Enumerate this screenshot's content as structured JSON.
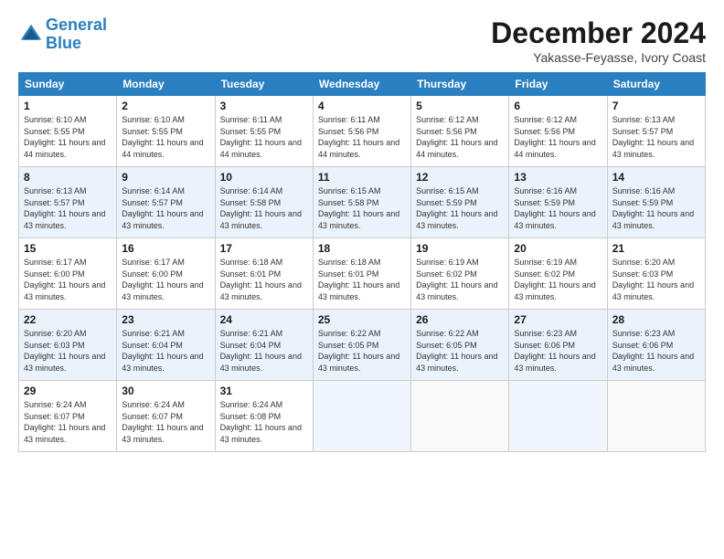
{
  "header": {
    "logo_line1": "General",
    "logo_line2": "Blue",
    "month_title": "December 2024",
    "location": "Yakasse-Feyasse, Ivory Coast"
  },
  "days_of_week": [
    "Sunday",
    "Monday",
    "Tuesday",
    "Wednesday",
    "Thursday",
    "Friday",
    "Saturday"
  ],
  "weeks": [
    [
      {
        "day": 1,
        "sunrise": "6:10 AM",
        "sunset": "5:55 PM",
        "daylight": "11 hours and 44 minutes."
      },
      {
        "day": 2,
        "sunrise": "6:10 AM",
        "sunset": "5:55 PM",
        "daylight": "11 hours and 44 minutes."
      },
      {
        "day": 3,
        "sunrise": "6:11 AM",
        "sunset": "5:55 PM",
        "daylight": "11 hours and 44 minutes."
      },
      {
        "day": 4,
        "sunrise": "6:11 AM",
        "sunset": "5:56 PM",
        "daylight": "11 hours and 44 minutes."
      },
      {
        "day": 5,
        "sunrise": "6:12 AM",
        "sunset": "5:56 PM",
        "daylight": "11 hours and 44 minutes."
      },
      {
        "day": 6,
        "sunrise": "6:12 AM",
        "sunset": "5:56 PM",
        "daylight": "11 hours and 44 minutes."
      },
      {
        "day": 7,
        "sunrise": "6:13 AM",
        "sunset": "5:57 PM",
        "daylight": "11 hours and 43 minutes."
      }
    ],
    [
      {
        "day": 8,
        "sunrise": "6:13 AM",
        "sunset": "5:57 PM",
        "daylight": "11 hours and 43 minutes."
      },
      {
        "day": 9,
        "sunrise": "6:14 AM",
        "sunset": "5:57 PM",
        "daylight": "11 hours and 43 minutes."
      },
      {
        "day": 10,
        "sunrise": "6:14 AM",
        "sunset": "5:58 PM",
        "daylight": "11 hours and 43 minutes."
      },
      {
        "day": 11,
        "sunrise": "6:15 AM",
        "sunset": "5:58 PM",
        "daylight": "11 hours and 43 minutes."
      },
      {
        "day": 12,
        "sunrise": "6:15 AM",
        "sunset": "5:59 PM",
        "daylight": "11 hours and 43 minutes."
      },
      {
        "day": 13,
        "sunrise": "6:16 AM",
        "sunset": "5:59 PM",
        "daylight": "11 hours and 43 minutes."
      },
      {
        "day": 14,
        "sunrise": "6:16 AM",
        "sunset": "5:59 PM",
        "daylight": "11 hours and 43 minutes."
      }
    ],
    [
      {
        "day": 15,
        "sunrise": "6:17 AM",
        "sunset": "6:00 PM",
        "daylight": "11 hours and 43 minutes."
      },
      {
        "day": 16,
        "sunrise": "6:17 AM",
        "sunset": "6:00 PM",
        "daylight": "11 hours and 43 minutes."
      },
      {
        "day": 17,
        "sunrise": "6:18 AM",
        "sunset": "6:01 PM",
        "daylight": "11 hours and 43 minutes."
      },
      {
        "day": 18,
        "sunrise": "6:18 AM",
        "sunset": "6:01 PM",
        "daylight": "11 hours and 43 minutes."
      },
      {
        "day": 19,
        "sunrise": "6:19 AM",
        "sunset": "6:02 PM",
        "daylight": "11 hours and 43 minutes."
      },
      {
        "day": 20,
        "sunrise": "6:19 AM",
        "sunset": "6:02 PM",
        "daylight": "11 hours and 43 minutes."
      },
      {
        "day": 21,
        "sunrise": "6:20 AM",
        "sunset": "6:03 PM",
        "daylight": "11 hours and 43 minutes."
      }
    ],
    [
      {
        "day": 22,
        "sunrise": "6:20 AM",
        "sunset": "6:03 PM",
        "daylight": "11 hours and 43 minutes."
      },
      {
        "day": 23,
        "sunrise": "6:21 AM",
        "sunset": "6:04 PM",
        "daylight": "11 hours and 43 minutes."
      },
      {
        "day": 24,
        "sunrise": "6:21 AM",
        "sunset": "6:04 PM",
        "daylight": "11 hours and 43 minutes."
      },
      {
        "day": 25,
        "sunrise": "6:22 AM",
        "sunset": "6:05 PM",
        "daylight": "11 hours and 43 minutes."
      },
      {
        "day": 26,
        "sunrise": "6:22 AM",
        "sunset": "6:05 PM",
        "daylight": "11 hours and 43 minutes."
      },
      {
        "day": 27,
        "sunrise": "6:23 AM",
        "sunset": "6:06 PM",
        "daylight": "11 hours and 43 minutes."
      },
      {
        "day": 28,
        "sunrise": "6:23 AM",
        "sunset": "6:06 PM",
        "daylight": "11 hours and 43 minutes."
      }
    ],
    [
      {
        "day": 29,
        "sunrise": "6:24 AM",
        "sunset": "6:07 PM",
        "daylight": "11 hours and 43 minutes."
      },
      {
        "day": 30,
        "sunrise": "6:24 AM",
        "sunset": "6:07 PM",
        "daylight": "11 hours and 43 minutes."
      },
      {
        "day": 31,
        "sunrise": "6:24 AM",
        "sunset": "6:08 PM",
        "daylight": "11 hours and 43 minutes."
      },
      null,
      null,
      null,
      null
    ]
  ],
  "labels": {
    "sunrise_prefix": "Sunrise: ",
    "sunset_prefix": "Sunset: ",
    "daylight_prefix": "Daylight: "
  }
}
